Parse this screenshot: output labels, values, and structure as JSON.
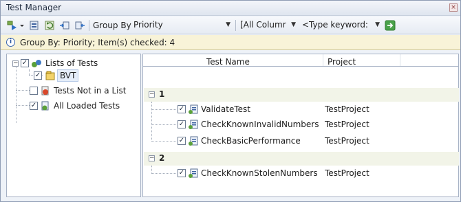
{
  "window": {
    "title": "Test Manager",
    "close_glyph": "×"
  },
  "toolbar": {
    "group_by_label": "Group By",
    "group_by_value": "Priority",
    "filter_column_value": "[All Columr",
    "keyword_placeholder": "<Type keyword:",
    "icons": [
      "run-tests-icon",
      "dropdown-icon",
      "load-metadata-icon",
      "refresh-icon",
      "add-to-list-icon",
      "remove-from-list-icon",
      "apply-filter-icon"
    ]
  },
  "infobar": {
    "message": "Group By: Priority; Item(s) checked: 4"
  },
  "tree": {
    "items": [
      {
        "label": "Lists of Tests",
        "checked": true
      },
      {
        "label": "BVT",
        "checked": true
      },
      {
        "label": "Tests Not in a List",
        "checked": false
      },
      {
        "label": "All Loaded Tests",
        "checked": true
      }
    ]
  },
  "grid": {
    "columns": [
      "Test Name",
      "Project"
    ],
    "groups": [
      {
        "label": "1",
        "rows": [
          {
            "name": "ValidateTest",
            "project": "TestProject"
          },
          {
            "name": "CheckKnownInvalidNumbers",
            "project": "TestProject"
          },
          {
            "name": "CheckBasicPerformance",
            "project": "TestProject"
          }
        ]
      },
      {
        "label": "2",
        "rows": [
          {
            "name": "CheckKnownStolenNumbers",
            "project": "TestProject"
          }
        ]
      }
    ]
  },
  "colors": {
    "accent": "#3a66b0",
    "info_bg": "#f8f3d8",
    "group_bg": "#f2f4e8"
  }
}
